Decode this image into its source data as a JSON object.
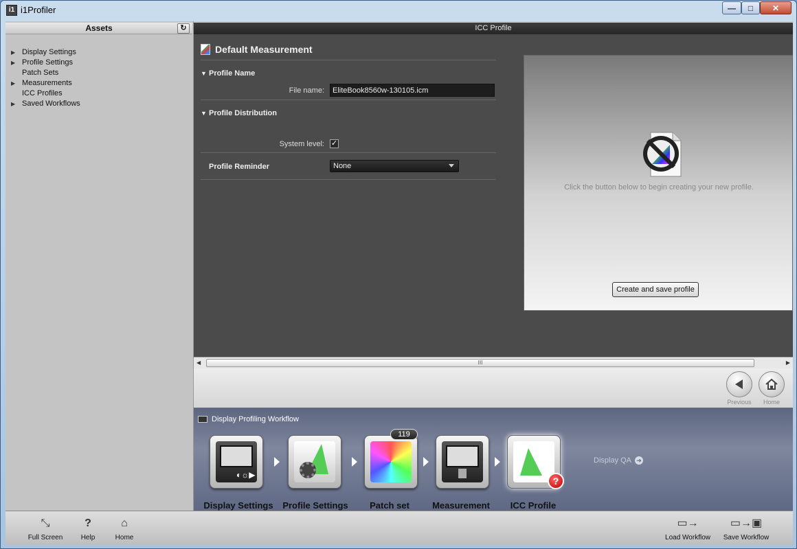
{
  "window": {
    "title": "i1Profiler",
    "app_icon": "i1",
    "min": "—",
    "max": "□",
    "close": "✕"
  },
  "assets": {
    "header": "Assets",
    "refresh_icon": "refresh-icon",
    "items": [
      {
        "label": "Display Settings",
        "expandable": true
      },
      {
        "label": "Profile Settings",
        "expandable": true
      },
      {
        "label": "Patch Sets",
        "expandable": false
      },
      {
        "label": "Measurements",
        "expandable": true
      },
      {
        "label": "ICC Profiles",
        "expandable": false
      },
      {
        "label": "Saved Workflows",
        "expandable": true
      }
    ]
  },
  "main": {
    "header": "ICC Profile",
    "title": "Default Measurement",
    "profile_name": {
      "section": "Profile Name",
      "file_label": "File name:",
      "file_value": "EliteBook8560w-130105.icm"
    },
    "distribution": {
      "section": "Profile Distribution",
      "system_label": "System level:",
      "system_checked": true,
      "check_mark": "✓"
    },
    "reminder": {
      "label": "Profile Reminder",
      "value": "None"
    },
    "preview": {
      "message": "Click the button below to begin creating your new profile.",
      "create_button": "Create and save profile"
    }
  },
  "scrollbar": {
    "grip": "III"
  },
  "nav": {
    "previous": "Previous",
    "home": "Home"
  },
  "workflow": {
    "title": "Display Profiling Workflow",
    "steps": [
      {
        "label": "Display Settings"
      },
      {
        "label": "Profile Settings"
      },
      {
        "label": "Patch set",
        "badge": "119"
      },
      {
        "label": "Measurement"
      },
      {
        "label": "ICC Profile",
        "error": "?"
      }
    ],
    "qa_link": "Display QA",
    "qa_arrow": "➔"
  },
  "toolbar": {
    "full_screen": "Full Screen",
    "help": "Help",
    "help_icon": "?",
    "home": "Home",
    "load_workflow": "Load Workflow",
    "save_workflow": "Save Workflow"
  }
}
